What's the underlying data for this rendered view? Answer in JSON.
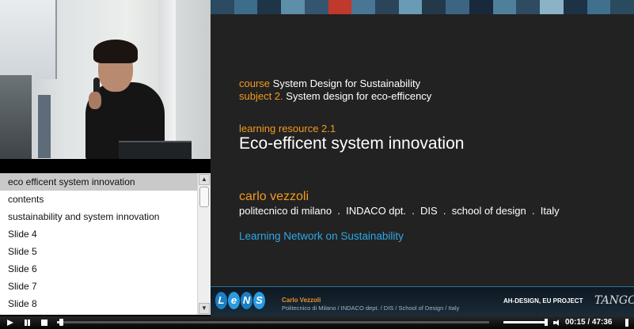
{
  "playlist": {
    "items": [
      "eco efficent system innovation",
      "contents",
      "sustainability and system innovation",
      "Slide 4",
      "Slide 5",
      "Slide 6",
      "Slide 7",
      "Slide 8"
    ],
    "active_index": 0,
    "scroll_up_icon": "arrow-up-icon",
    "scroll_down_icon": "arrow-down-icon"
  },
  "slide": {
    "course_label": "course",
    "course_value": "System Design for Sustainability",
    "subject_label": "subject 2.",
    "subject_value": "System design for eco-efficency",
    "resource_label": "learning resource 2.1",
    "title": "Eco-efficent system innovation",
    "author": "carlo vezzoli",
    "affiliation": "politecnico di milano  .  INDACO dpt.  .  DIS  .  school of design  .  Italy",
    "network": "Learning Network on Sustainability",
    "topbar_colors": [
      "#2c4a60",
      "#3e6d8c",
      "#1f3547",
      "#5d8eaa",
      "#33556f",
      "#c0392b",
      "#487694",
      "#2a4459",
      "#6a9ab5",
      "#23394a",
      "#3b6582",
      "#17293a",
      "#507f9c",
      "#2e4b62",
      "#8bb3c8",
      "#1d3244",
      "#40708e",
      "#2a4a5f"
    ],
    "colors": {
      "orange": "#f39a1e",
      "blue": "#2ea8e6",
      "background": "#222222"
    }
  },
  "footer": {
    "logo_letters": [
      "L",
      "e",
      "N",
      "S"
    ],
    "logo_colors": [
      "#1a7fc4",
      "#2a9be0",
      "#1a7fc4",
      "#2a9be0"
    ],
    "author": "Carlo Vezzoli",
    "affiliation": "Politecnico di Milano / INDACO dept. / DIS / School of Design / Italy",
    "project": "AH-DESIGN, EU PROJECT",
    "partner_logo": "TANGO"
  },
  "player": {
    "play_icon": "play-icon",
    "pause_icon": "pause-icon",
    "stop_icon": "stop-icon",
    "volume_icon": "speaker-icon",
    "fullscreen_icon": "fullscreen-icon",
    "time": "00:15 / 47:36",
    "progress_fraction": 0.0053,
    "volume_fraction": 1.0
  }
}
